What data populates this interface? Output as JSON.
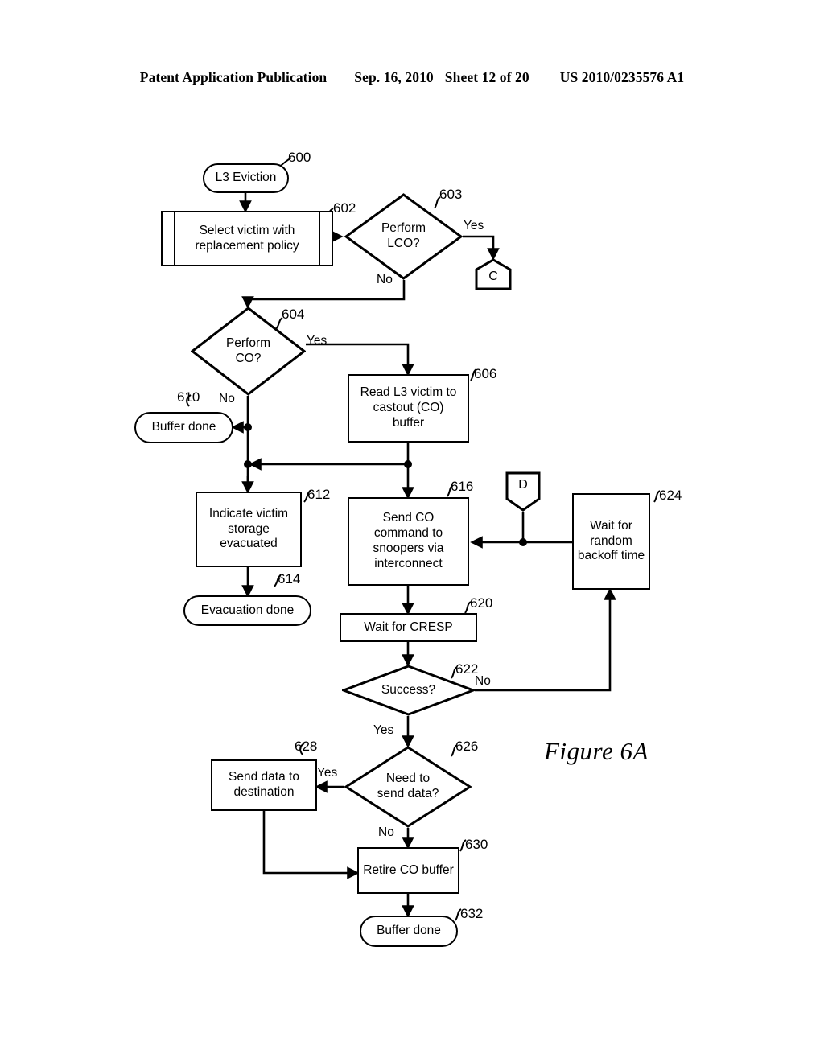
{
  "header": {
    "publication": "Patent Application Publication",
    "date": "Sep. 16, 2010",
    "sheet": "Sheet 12 of 20",
    "patent_number": "US 2010/0235576 A1"
  },
  "figure": {
    "caption": "Figure 6A"
  },
  "flowchart": {
    "nodes": [
      {
        "id": "600",
        "ref": "600",
        "type": "terminal",
        "text": "L3 Eviction"
      },
      {
        "id": "602",
        "ref": "602",
        "type": "predefined-process",
        "text": "Select victim with replacement policy"
      },
      {
        "id": "603",
        "ref": "603",
        "type": "decision",
        "text": "Perform\nLCO?"
      },
      {
        "id": "C",
        "ref": "",
        "type": "connector",
        "text": "C"
      },
      {
        "id": "604",
        "ref": "604",
        "type": "decision",
        "text": "Perform\nCO?"
      },
      {
        "id": "606",
        "ref": "606",
        "type": "process",
        "text": "Read L3 victim to castout (CO) buffer"
      },
      {
        "id": "610",
        "ref": "610",
        "type": "terminal",
        "text": "Buffer done"
      },
      {
        "id": "612",
        "ref": "612",
        "type": "process",
        "text": "Indicate victim storage evacuated"
      },
      {
        "id": "614",
        "ref": "614",
        "type": "terminal",
        "text": "Evacuation done"
      },
      {
        "id": "616",
        "ref": "616",
        "type": "process",
        "text": "Send CO command to snoopers via interconnect"
      },
      {
        "id": "D",
        "ref": "",
        "type": "connector",
        "text": "D"
      },
      {
        "id": "624",
        "ref": "624",
        "type": "process",
        "text": "Wait for random backoff time"
      },
      {
        "id": "620",
        "ref": "620",
        "type": "process",
        "text": "Wait for CRESP"
      },
      {
        "id": "622",
        "ref": "622",
        "type": "decision",
        "text": "Success?"
      },
      {
        "id": "626",
        "ref": "626",
        "type": "decision",
        "text": "Need to\nsend data?"
      },
      {
        "id": "628",
        "ref": "628",
        "type": "process",
        "text": "Send data to destination"
      },
      {
        "id": "630",
        "ref": "630",
        "type": "process",
        "text": "Retire CO buffer"
      },
      {
        "id": "632",
        "ref": "632",
        "type": "terminal",
        "text": "Buffer done"
      }
    ],
    "edge_labels": {
      "lco_yes": "Yes",
      "lco_no": "No",
      "co_yes": "Yes",
      "co_no": "No",
      "success_no": "No",
      "success_yes": "Yes",
      "senddata_yes": "Yes",
      "senddata_no": "No"
    },
    "refs": {
      "r600": "600",
      "r602": "602",
      "r603": "603",
      "r604": "604",
      "r606": "606",
      "r610": "610",
      "r612": "612",
      "r614": "614",
      "r616": "616",
      "r620": "620",
      "r622": "622",
      "r624": "624",
      "r626": "626",
      "r628": "628",
      "r630": "630",
      "r632": "632"
    },
    "connector_labels": {
      "c": "C",
      "d": "D"
    },
    "colors": {
      "ink": "#000000",
      "paper": "#ffffff"
    }
  }
}
